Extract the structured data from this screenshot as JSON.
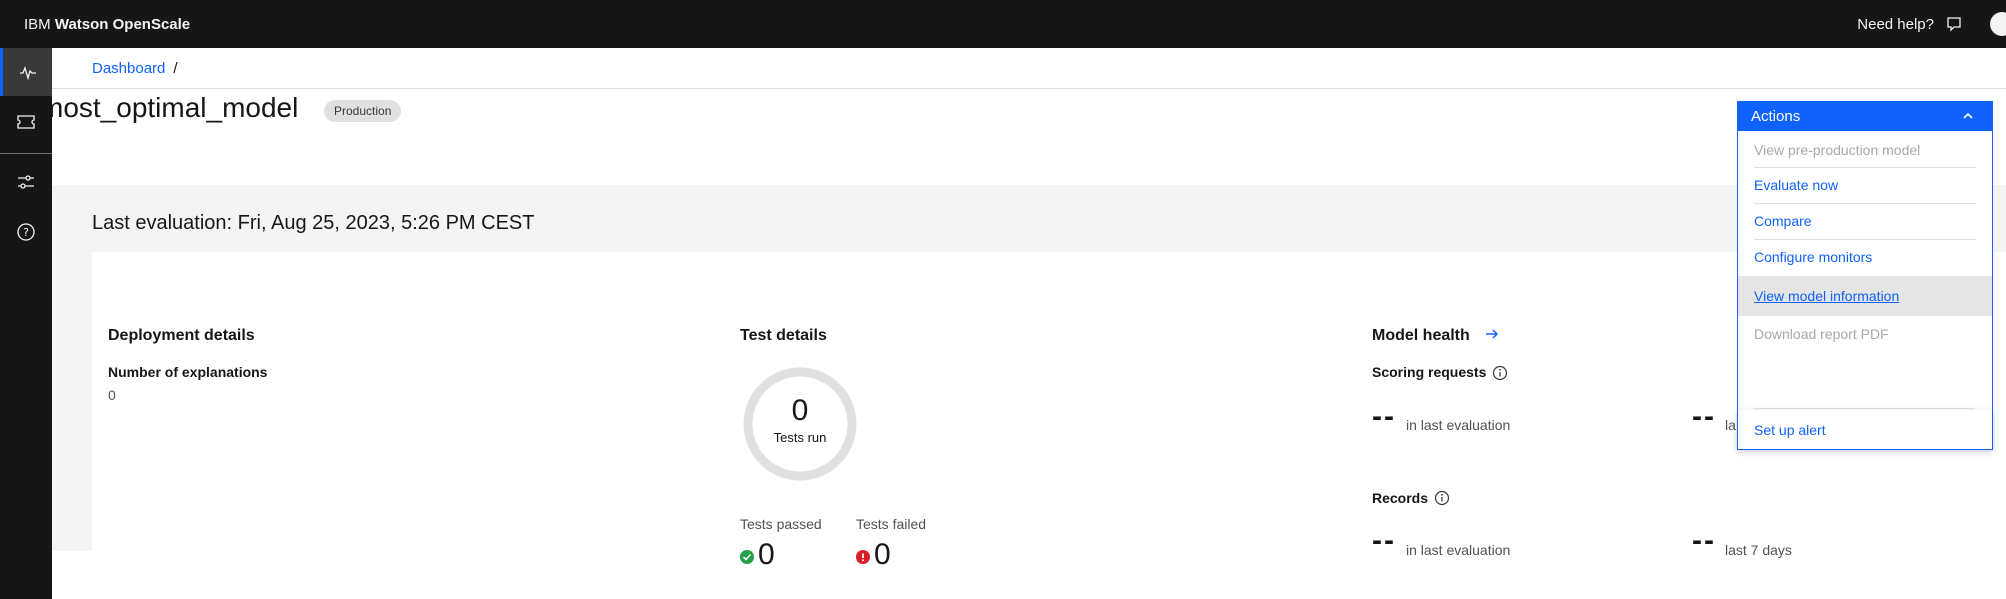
{
  "header": {
    "brand_prefix": "IBM",
    "brand_name": "Watson OpenScale",
    "help_label": "Need help?"
  },
  "sidenav": {
    "items": [
      {
        "icon": "activity-icon",
        "active": true
      },
      {
        "icon": "ticket-icon",
        "active": false
      },
      {
        "icon": "sliders-icon",
        "active": false
      },
      {
        "icon": "help-circle-icon",
        "active": false
      }
    ]
  },
  "breadcrumb": {
    "items": [
      "Dashboard"
    ],
    "separator": "/"
  },
  "page": {
    "title": "most_optimal_model",
    "tag": "Production",
    "last_evaluation": "Last evaluation: Fri, Aug 25, 2023, 5:26 PM CEST"
  },
  "deployment": {
    "heading": "Deployment details",
    "label": "Number of explanations",
    "value": "0"
  },
  "tests": {
    "heading": "Test details",
    "tests_run_value": "0",
    "tests_run_label": "Tests run",
    "passed_label": "Tests passed",
    "passed_value": "0",
    "failed_label": "Tests failed",
    "failed_value": "0"
  },
  "health": {
    "heading": "Model health",
    "scoring_label": "Scoring requests",
    "scoring_last_eval_value": "--",
    "scoring_last_eval_label": "in last evaluation",
    "scoring_7d_value": "--",
    "scoring_7d_label": "la",
    "records_label": "Records",
    "records_last_eval_value": "--",
    "records_last_eval_label": "in last evaluation",
    "records_7d_value": "--",
    "records_7d_label": "last 7 days"
  },
  "actions": {
    "label": "Actions",
    "menu": [
      {
        "label": "View pre-production model",
        "state": "disabled"
      },
      {
        "label": "Evaluate now",
        "state": "enabled"
      },
      {
        "label": "Compare",
        "state": "enabled"
      },
      {
        "label": "Configure monitors",
        "state": "enabled"
      },
      {
        "label": "View model information",
        "state": "hover"
      },
      {
        "label": "Download report PDF",
        "state": "disabled"
      },
      {
        "label": "Set up alert",
        "state": "enabled"
      }
    ]
  },
  "colors": {
    "accent": "#0f62fe",
    "topbar": "#161616",
    "success": "#24a148",
    "error": "#da1e28"
  }
}
